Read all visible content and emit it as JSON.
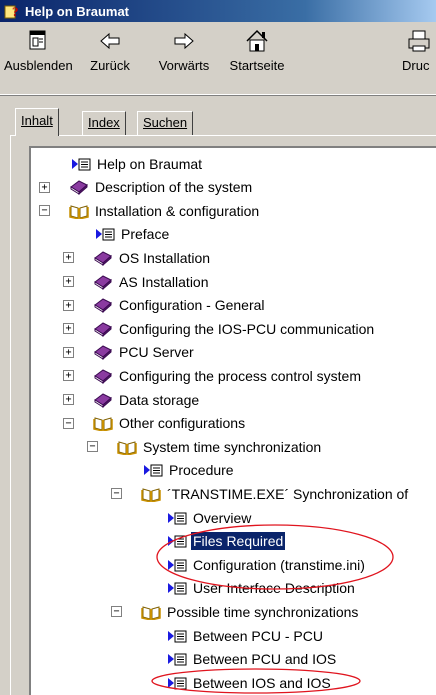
{
  "window": {
    "title": "Help on Braumat"
  },
  "toolbar": {
    "buttons": [
      {
        "label": "Ausblenden",
        "icon": "hide-icon"
      },
      {
        "label": "Zurück",
        "icon": "back-arrow-icon"
      },
      {
        "label": "Vorwärts",
        "icon": "forward-arrow-icon"
      },
      {
        "label": "Startseite",
        "icon": "home-icon"
      },
      {
        "label": "Druc",
        "icon": "print-icon"
      }
    ]
  },
  "tabs": [
    {
      "label": "Inhalt",
      "active": true
    },
    {
      "label": "Index",
      "active": false
    },
    {
      "label": "Suchen",
      "active": false
    }
  ],
  "tree": {
    "items": [
      {
        "label": "Help on Braumat",
        "type": "page",
        "expander": ""
      },
      {
        "label": "Description of the system",
        "type": "book-closed",
        "expander": "+"
      },
      {
        "label": "Installation & configuration",
        "type": "book-open",
        "expander": "−"
      },
      {
        "label": "Preface",
        "type": "page",
        "expander": ""
      },
      {
        "label": "OS Installation",
        "type": "book-closed",
        "expander": "+"
      },
      {
        "label": "AS Installation",
        "type": "book-closed",
        "expander": "+"
      },
      {
        "label": "Configuration - General",
        "type": "book-closed",
        "expander": "+"
      },
      {
        "label": "Configuring the IOS-PCU communication",
        "type": "book-closed",
        "expander": "+"
      },
      {
        "label": "PCU Server",
        "type": "book-closed",
        "expander": "+"
      },
      {
        "label": "Configuring the process control system",
        "type": "book-closed",
        "expander": "+"
      },
      {
        "label": "Data storage",
        "type": "book-closed",
        "expander": "+"
      },
      {
        "label": "Other configurations",
        "type": "book-open",
        "expander": "−"
      },
      {
        "label": "System time synchronization",
        "type": "book-open",
        "expander": "−"
      },
      {
        "label": "Procedure",
        "type": "page",
        "expander": ""
      },
      {
        "label": "´TRANSTIME.EXE´ Synchronization of",
        "type": "book-open",
        "expander": "−"
      },
      {
        "label": "Overview",
        "type": "page",
        "expander": ""
      },
      {
        "label": "Files Required",
        "type": "page",
        "expander": "",
        "selected": true
      },
      {
        "label": "Configuration (transtime.ini)",
        "type": "page",
        "expander": ""
      },
      {
        "label": "User Interface Description",
        "type": "page",
        "expander": ""
      },
      {
        "label": "Possible time synchronizations",
        "type": "book-open",
        "expander": "−"
      },
      {
        "label": "Between PCU - PCU",
        "type": "page",
        "expander": ""
      },
      {
        "label": "Between PCU and IOS",
        "type": "page",
        "expander": ""
      },
      {
        "label": "Between IOS and IOS",
        "type": "page",
        "expander": ""
      }
    ]
  },
  "colors": {
    "selection": "#0a246a",
    "annotation": "#e0141e",
    "book": "#7a3090"
  }
}
